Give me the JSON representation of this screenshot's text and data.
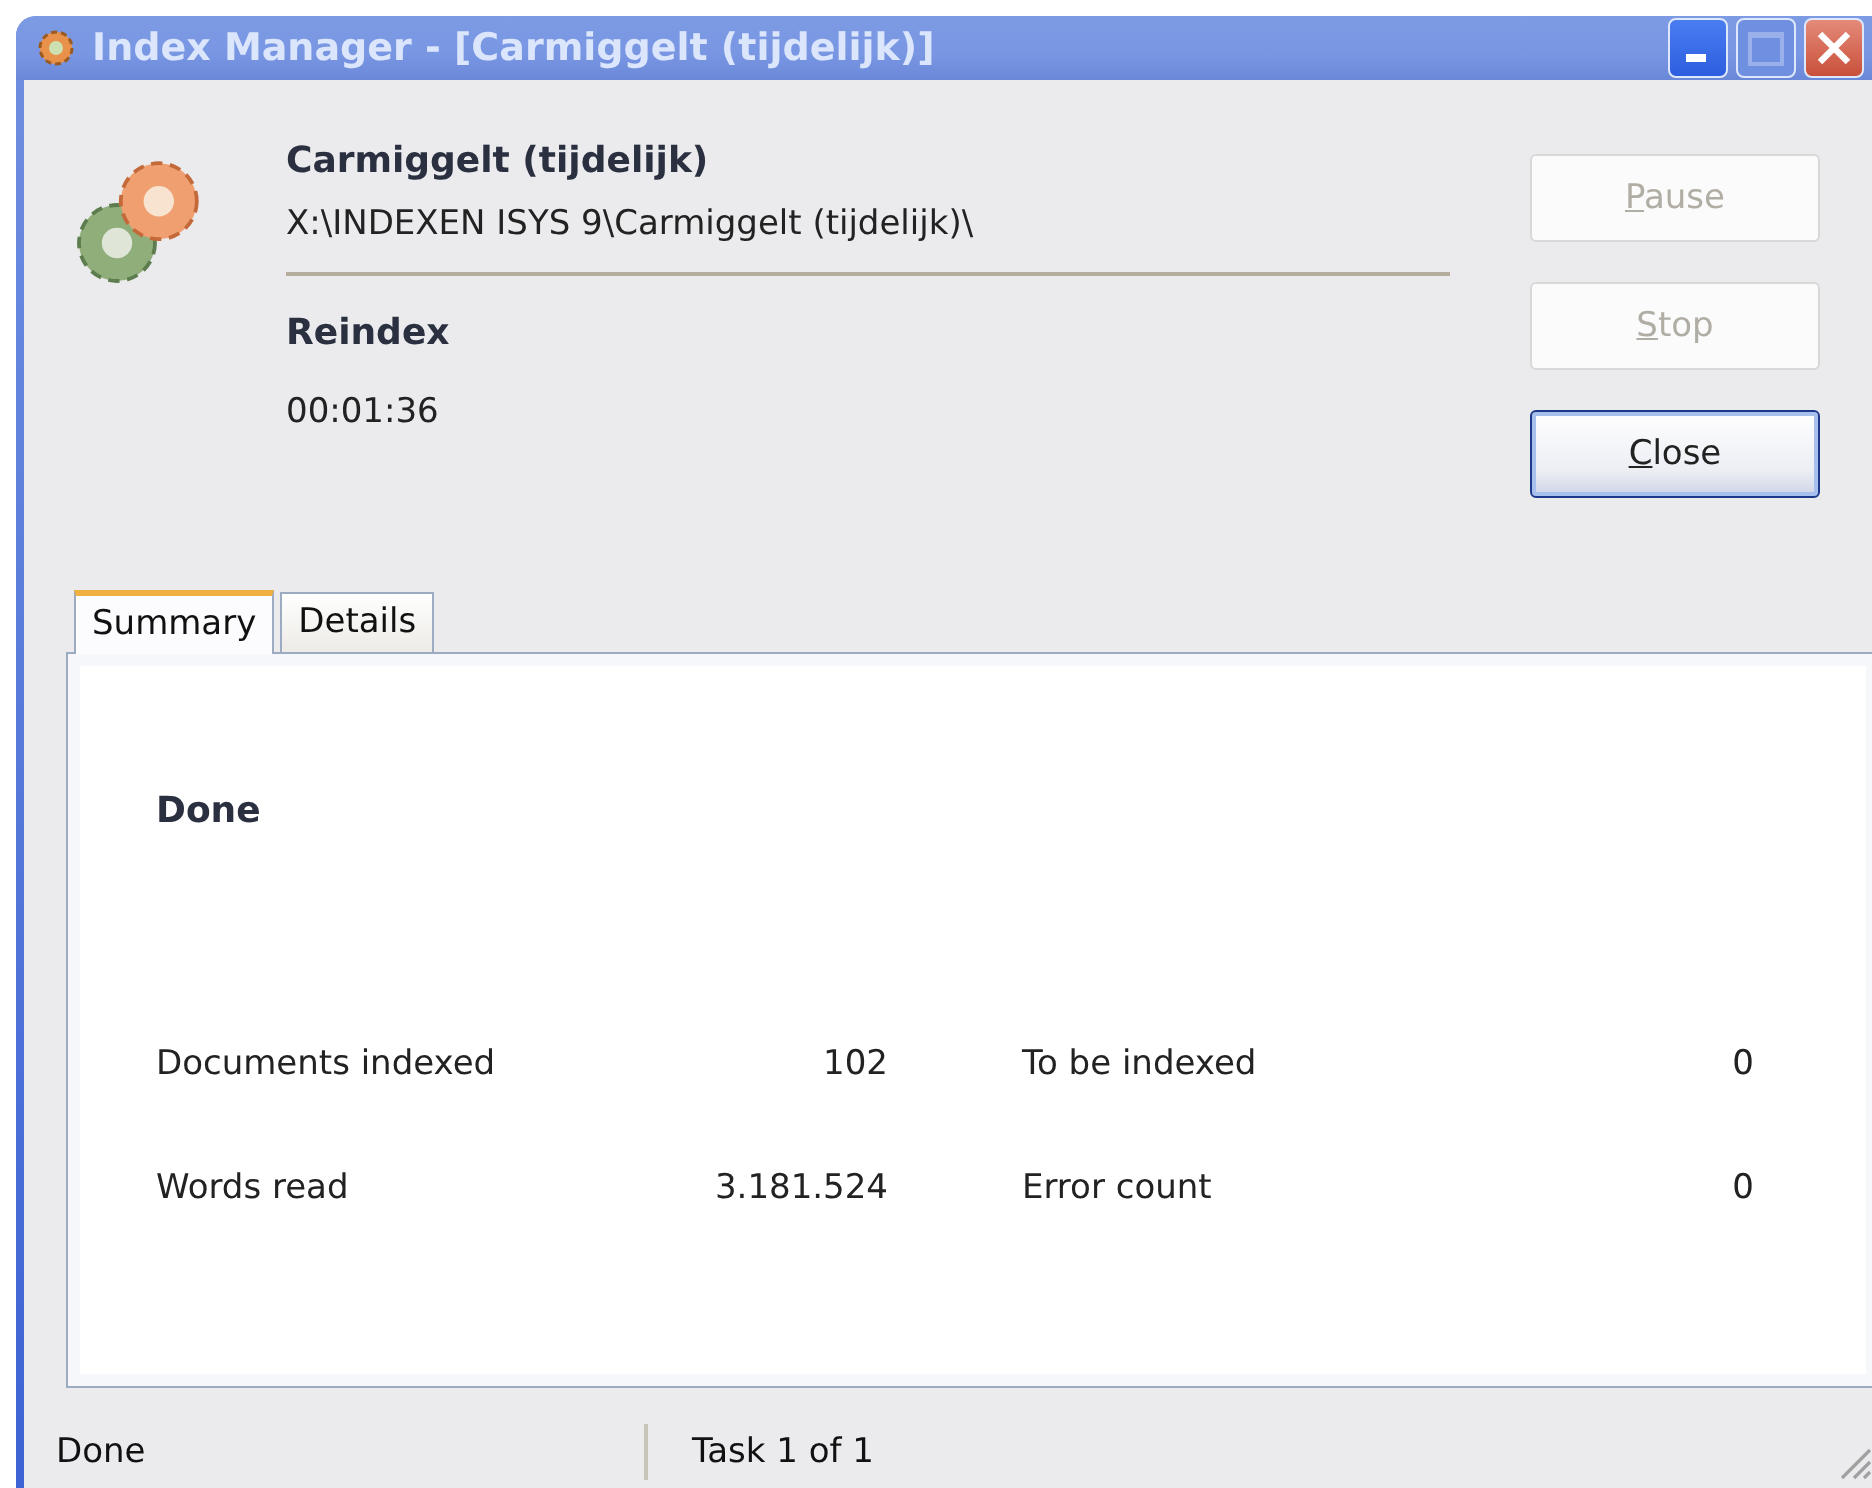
{
  "window": {
    "title": "Index Manager - [Carmiggelt (tijdelijk)]"
  },
  "index": {
    "name": "Carmiggelt (tijdelijk)",
    "path": "X:\\INDEXEN ISYS 9\\Carmiggelt (tijdelijk)\\",
    "operation": "Reindex",
    "elapsed": "00:01:36"
  },
  "buttons": [
    {
      "label": "Pause",
      "disabled": true,
      "default": false
    },
    {
      "label": "Stop",
      "disabled": true,
      "default": false
    },
    {
      "label": "Close",
      "disabled": false,
      "default": true
    }
  ],
  "tabs": [
    {
      "label": "Summary",
      "selected": true
    },
    {
      "label": "Details",
      "selected": false
    }
  ],
  "summary": {
    "status": "Done",
    "stats": [
      {
        "label": "Documents indexed",
        "value": "102",
        "label_2": "To be indexed",
        "value_2": "0"
      },
      {
        "label": "Words read",
        "value": "3.181.524",
        "label_2": "Error count",
        "value_2": "0"
      }
    ]
  },
  "status_bar": [
    "Done",
    "Task 1 of 1"
  ]
}
